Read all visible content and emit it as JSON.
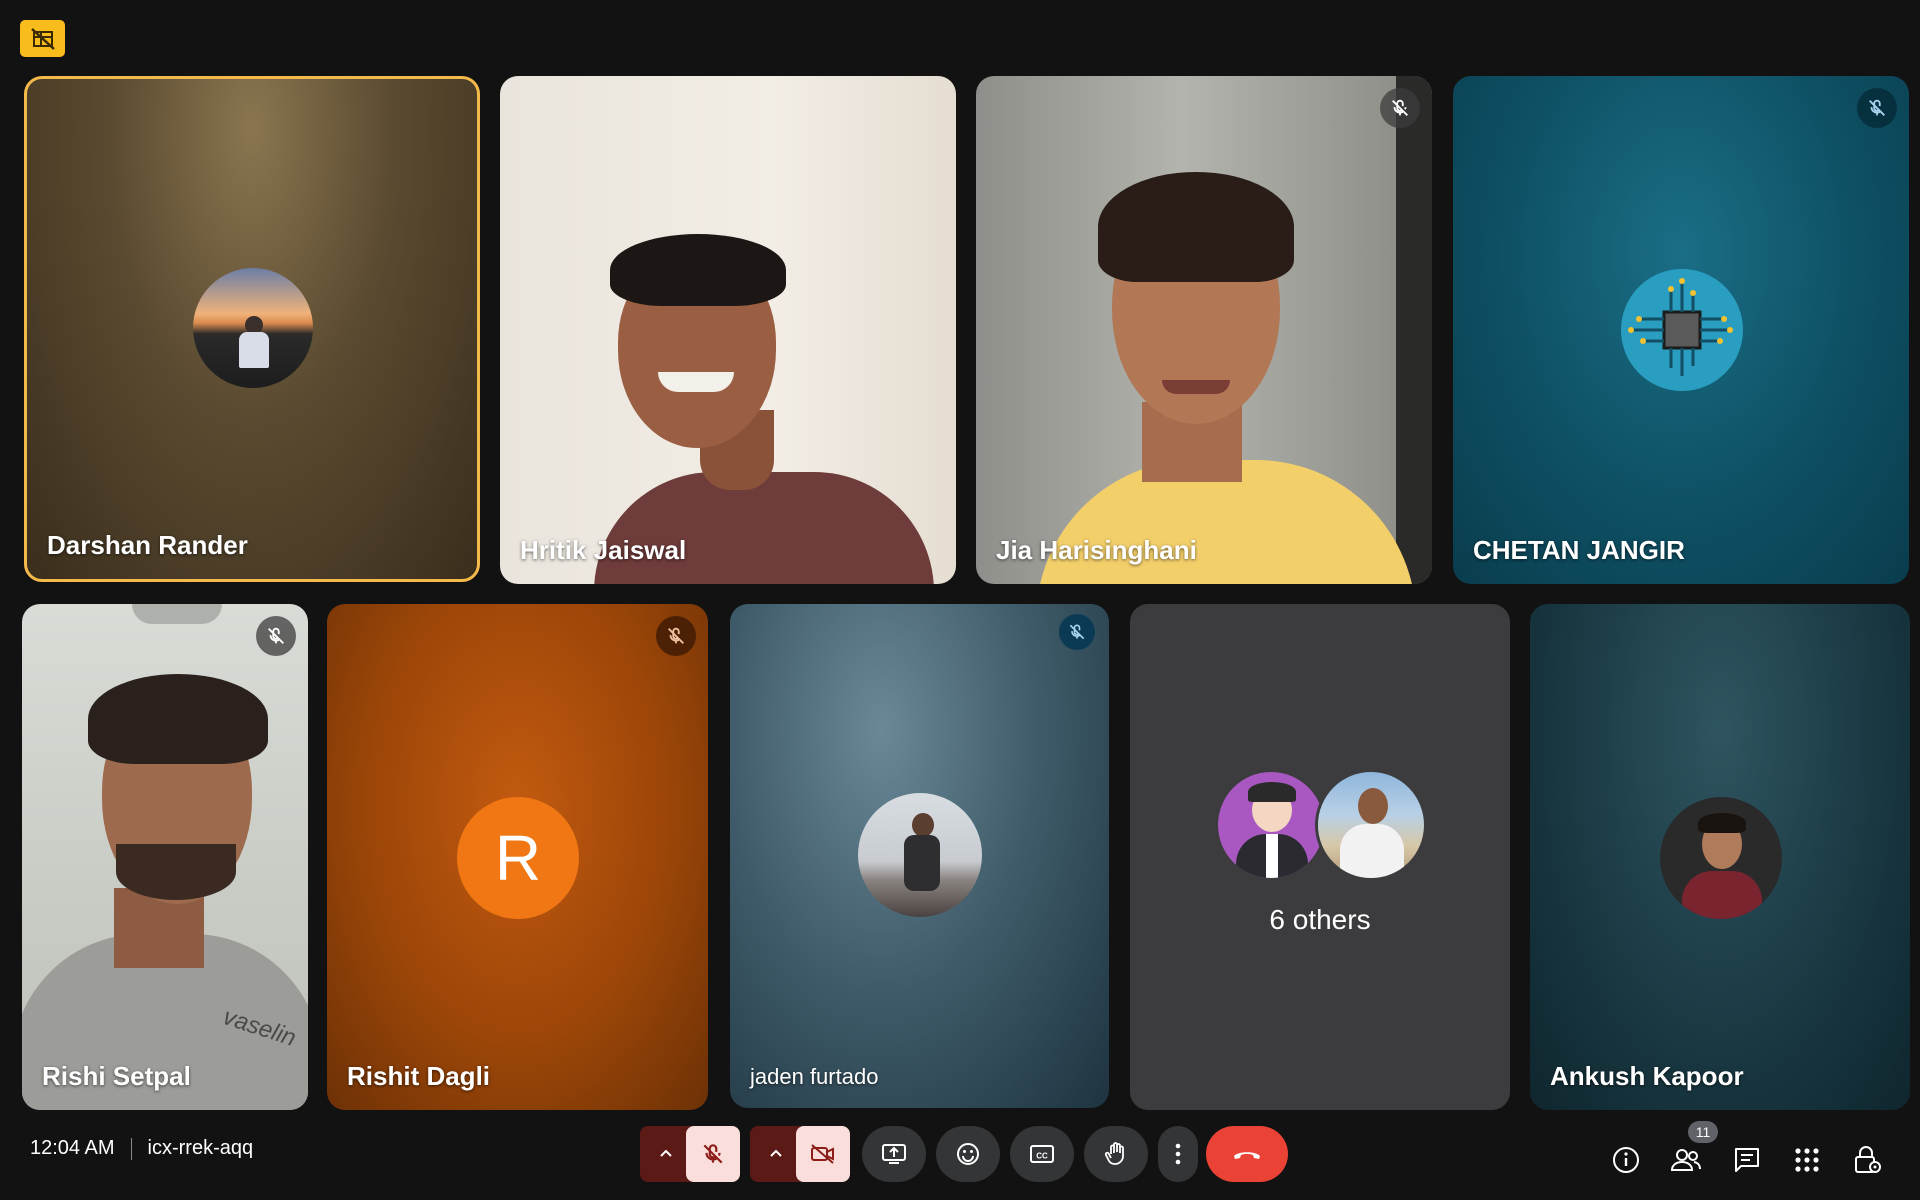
{
  "participants": [
    {
      "name": "Darshan Rander"
    },
    {
      "name": "Hritik Jaiswal"
    },
    {
      "name": "Jia Harisinghani"
    },
    {
      "name": "CHETAN JANGIR"
    },
    {
      "name": "Rishi Setpal"
    },
    {
      "name": "Rishit Dagli",
      "initial": "R"
    },
    {
      "name": "jaden furtado"
    },
    {
      "name": "Ankush Kapoor"
    }
  ],
  "others": {
    "label": "6 others"
  },
  "meeting": {
    "time": "12:04 AM",
    "code": "icx-rrek-aqq"
  },
  "people_count": "11",
  "shirt_text": "vaselin",
  "colors": {
    "accent_yellow": "#f9bc1d",
    "end_call": "#ea4335",
    "muted_red": "#f9dedc",
    "dark_red": "#8c1d18"
  },
  "icons": [
    "layout-badge-icon",
    "mic-off-icon",
    "camera-off-icon",
    "present-icon",
    "emoji-icon",
    "captions-icon",
    "raise-hand-icon",
    "more-icon",
    "end-call-icon",
    "info-icon",
    "people-icon",
    "chat-icon",
    "apps-icon",
    "host-controls-icon"
  ]
}
